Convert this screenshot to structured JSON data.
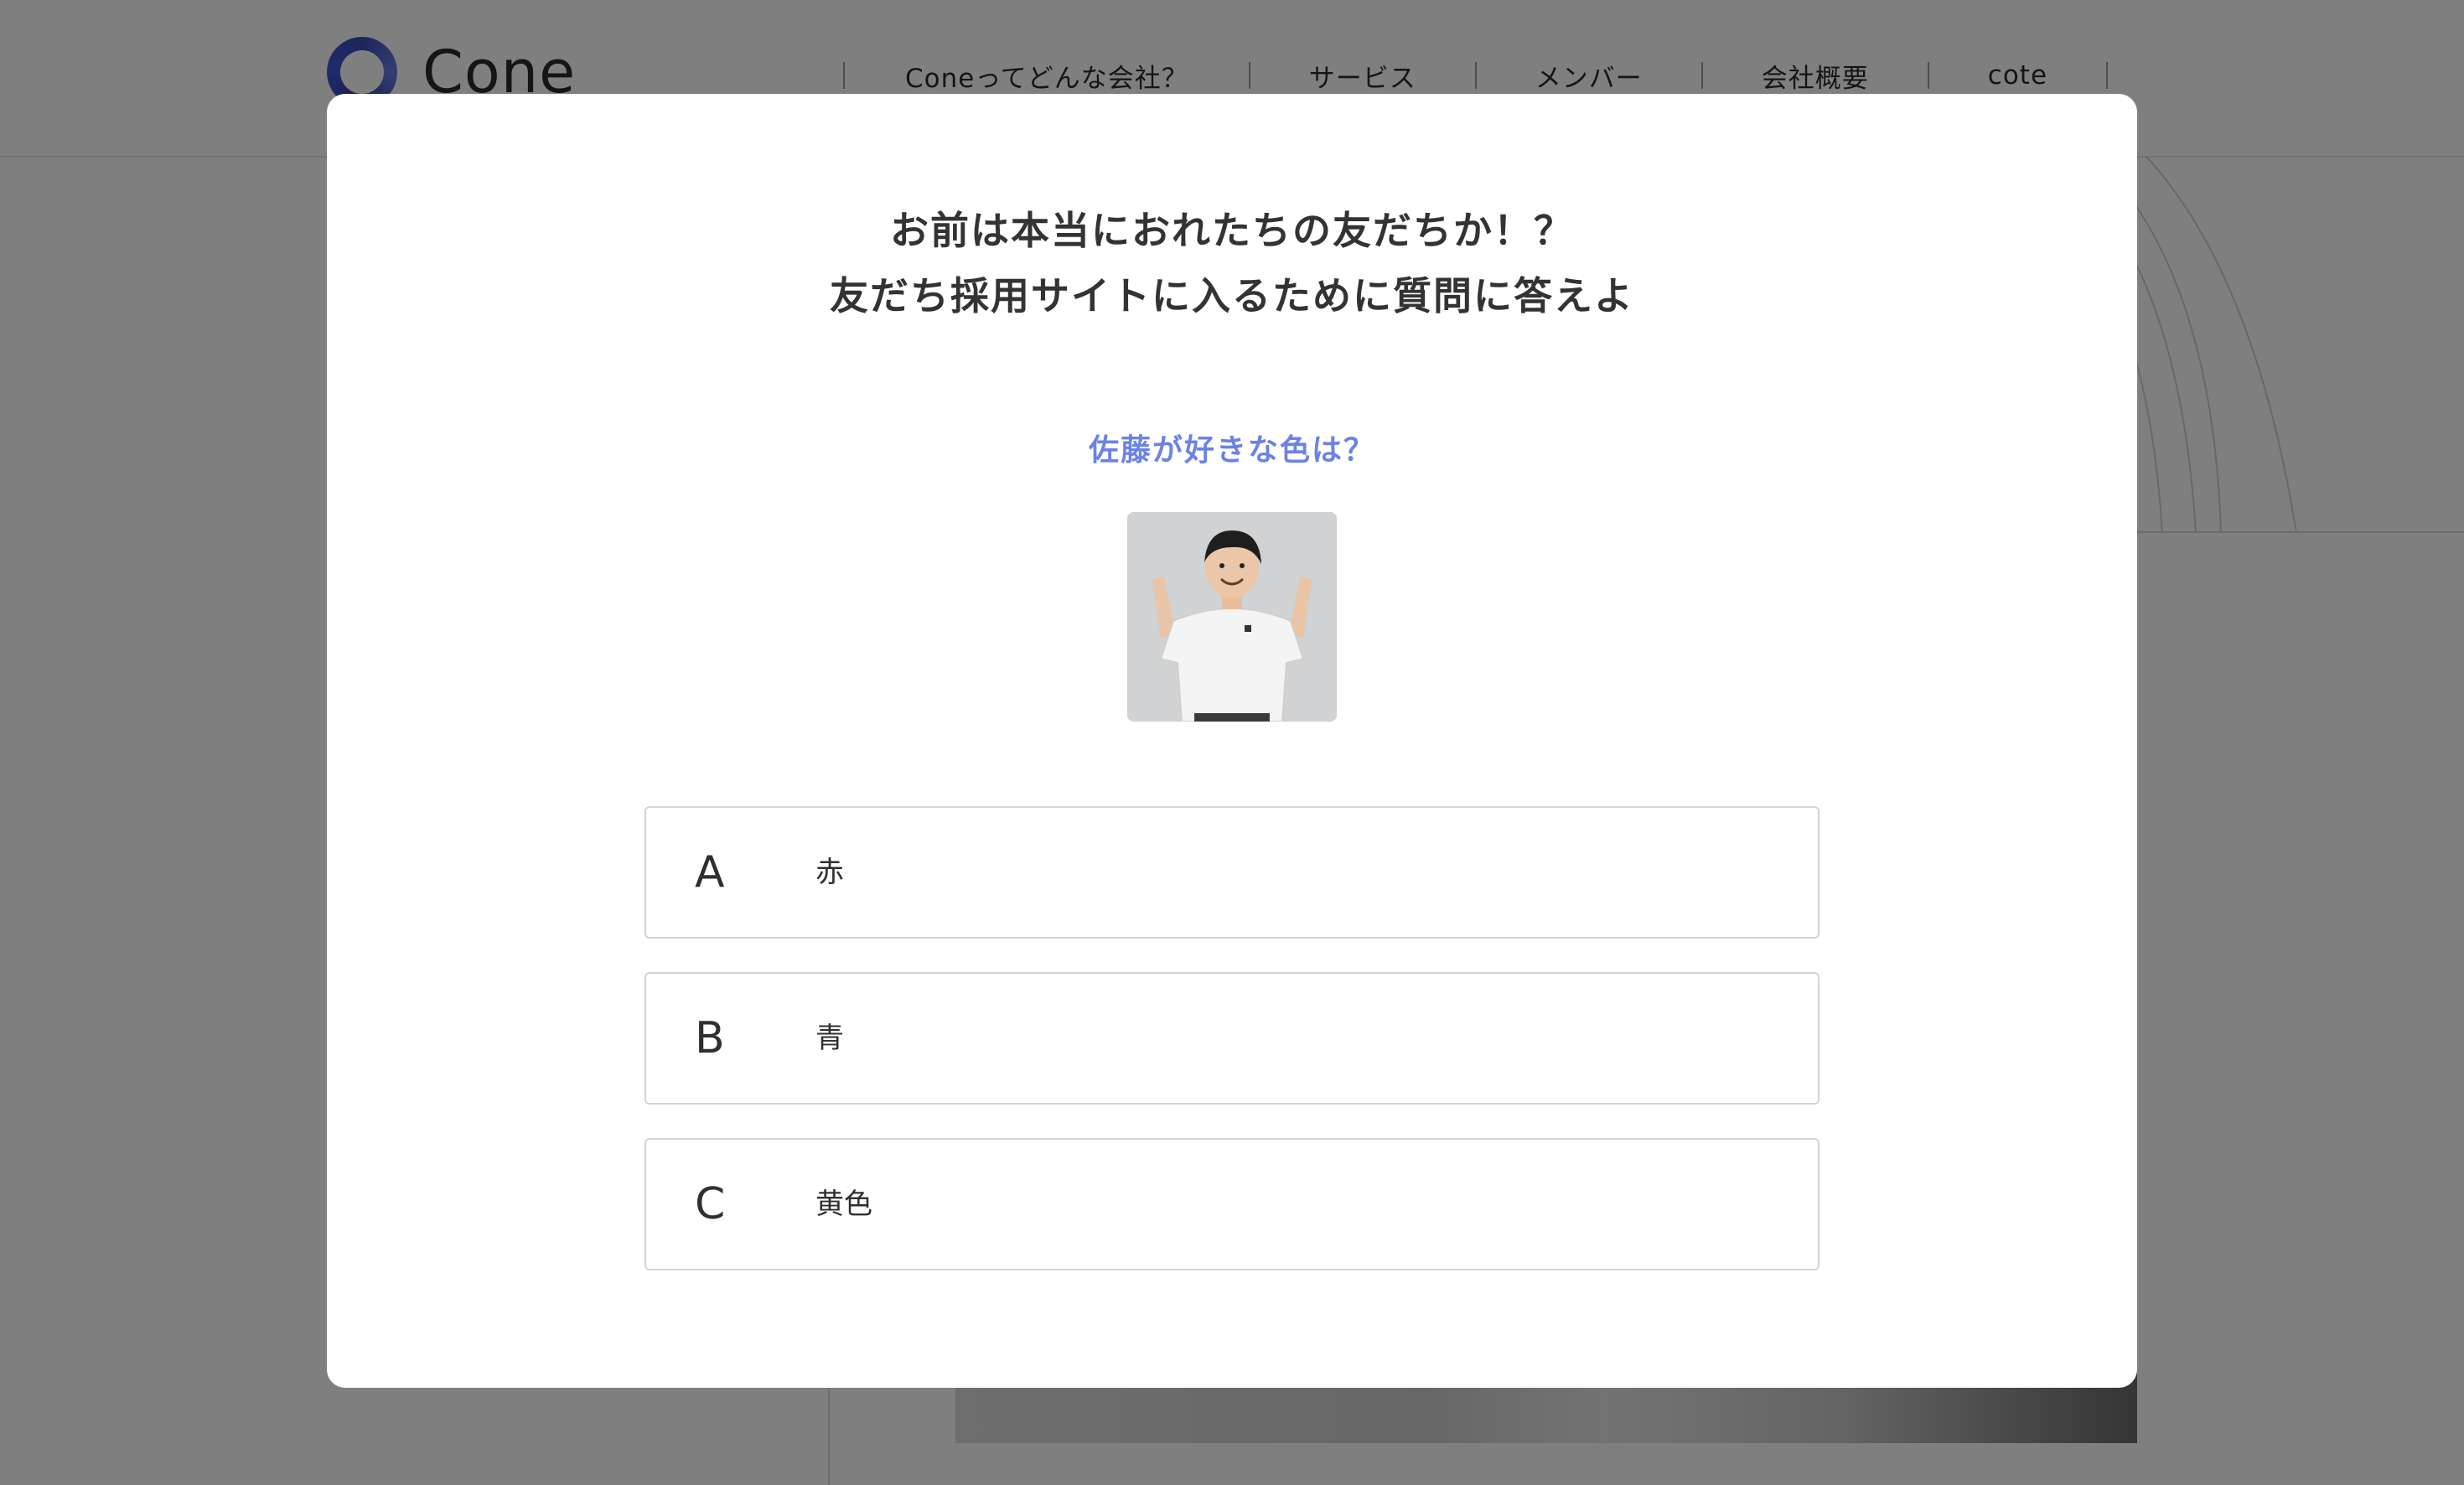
{
  "header": {
    "logo_text": "Cone",
    "nav": [
      {
        "label": "Coneってどんな会社？"
      },
      {
        "label": "サービス"
      },
      {
        "label": "メンバー"
      },
      {
        "label": "会社概要"
      },
      {
        "label": "cote"
      }
    ]
  },
  "modal": {
    "title_line1": "お前は本当におれたちの友だちか！？",
    "title_line2": "友だち採用サイトに入るために質問に答えよ",
    "question": "佐藤が好きな色は？",
    "photo_icon": "person-photo",
    "choices": [
      {
        "letter": "A",
        "text": "赤"
      },
      {
        "letter": "B",
        "text": "青"
      },
      {
        "letter": "C",
        "text": "黄色"
      }
    ]
  },
  "colors": {
    "accent": "#6b82e6",
    "overlay": "rgba(0,0,0,0.5)",
    "text": "#333333"
  }
}
